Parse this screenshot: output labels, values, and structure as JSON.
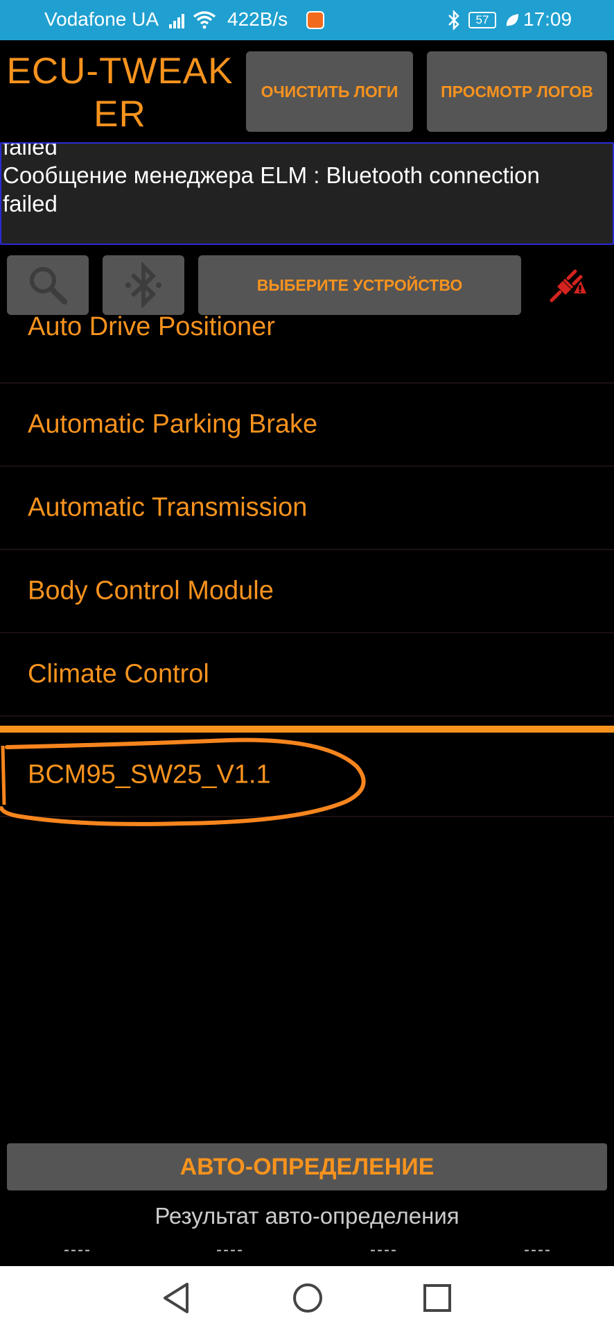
{
  "status_bar": {
    "carrier": "Vodafone UA",
    "speed": "422B/s",
    "battery": "57",
    "time": "17:09",
    "icons": [
      "signal-icon",
      "wifi-icon",
      "mi-notification-icon",
      "bluetooth-icon",
      "battery-icon",
      "leaf-icon"
    ]
  },
  "header": {
    "title": "ECU-TWEAKER",
    "clear_logs_label": "Очистить логи",
    "view_logs_label": "Просмотр логов"
  },
  "log": {
    "lines": [
      "failed",
      "Сообщение менеджера ELM : Bluetooth connection",
      "failed"
    ]
  },
  "toolbar": {
    "select_device_label": "Выберите устройство",
    "icons": [
      "search-icon",
      "bluetooth-icon",
      "disconnected-plug-icon"
    ]
  },
  "modules": {
    "items": [
      {
        "label": "Auto Drive Positioner"
      },
      {
        "label": "Automatic Parking Brake"
      },
      {
        "label": "Automatic Transmission"
      },
      {
        "label": "Body Control Module"
      },
      {
        "label": "Climate Control"
      }
    ]
  },
  "versions": {
    "items": [
      {
        "label": "BCM95_SW25_V1.1"
      }
    ]
  },
  "bottom": {
    "auto_detect_label": "Авто-определение",
    "auto_result_label": "Результат авто-определения",
    "placeholders": [
      "----",
      "----",
      "----",
      "----"
    ]
  },
  "colors": {
    "accent": "#f7931e",
    "status_bar": "#1fa0d0",
    "button": "#555555",
    "log_border": "#2a2ad8"
  },
  "nav": {
    "icons": [
      "back-icon",
      "home-icon",
      "recents-icon"
    ]
  }
}
